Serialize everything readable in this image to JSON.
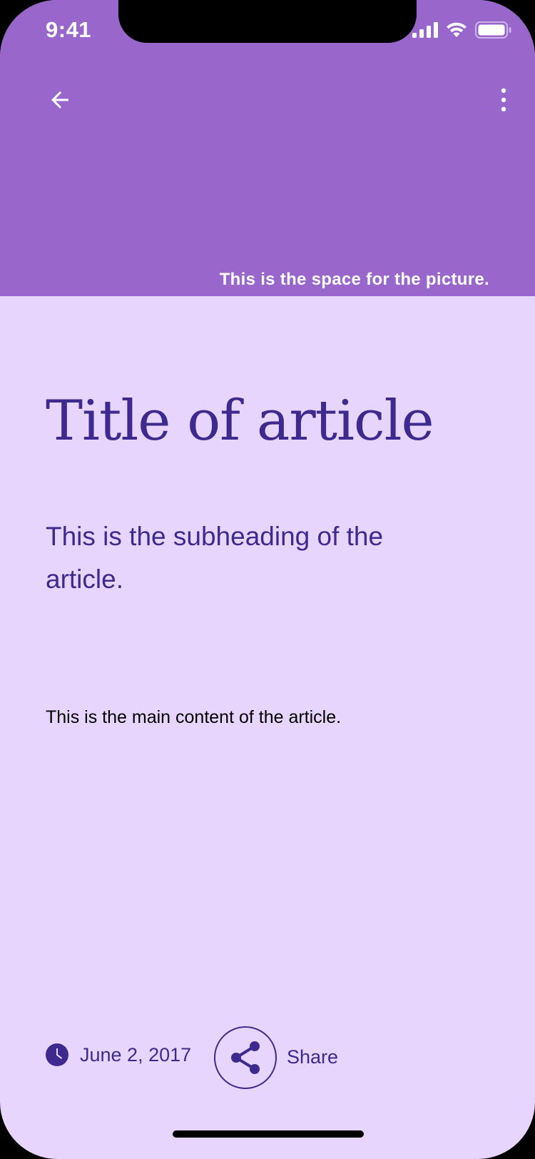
{
  "status_bar": {
    "time": "9:41"
  },
  "header": {
    "back_icon": "arrow-left-icon",
    "more_icon": "more-vertical-icon",
    "picture_caption": "This is the space for the picture."
  },
  "article": {
    "title": "Title of article",
    "subheading": "This is the subheading of the article.",
    "body": "This is the main content of the article."
  },
  "footer": {
    "date_icon": "clock-icon",
    "date": "June 2, 2017",
    "share_icon": "share-icon",
    "share_label": "Share"
  },
  "colors": {
    "header_background": "#9966cc",
    "page_background": "#e8d5fe",
    "accent_text": "#3e2a8f"
  }
}
